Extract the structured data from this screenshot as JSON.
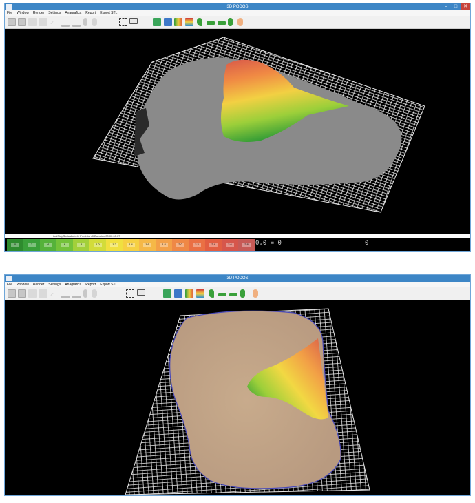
{
  "window1": {
    "title": "3D PODOS",
    "menu": [
      "File",
      "Window",
      "Render",
      "Settings",
      "Anagrafica",
      "Report",
      "Export STL"
    ],
    "status_text": "toolStripStatusLabel1  Precision 0  Duration 00:00:00.07",
    "legend_labels": [
      "0",
      "2",
      "4",
      "6",
      "8",
      "1.0",
      "1.2",
      "1.4",
      "1.6",
      "1.8",
      "2.0",
      "2.2",
      "2.4",
      "2.6",
      "2.8"
    ],
    "readout_left": "0,0 = 0",
    "readout_right": "0"
  },
  "window2": {
    "title": "3D PODOS",
    "menu": [
      "File",
      "Window",
      "Render",
      "Settings",
      "Anagrafica",
      "Report",
      "Export STL"
    ]
  },
  "colors": {
    "titlebar": "#3d86c6",
    "close": "#c7433b",
    "viewport": "#000000",
    "mesh": "#e6e6e6",
    "foot_gray": "#8a8a8a",
    "foot_skin": "#c8a98c",
    "legend": [
      "#2e8b2e",
      "#3aa03a",
      "#55b23a",
      "#73c23a",
      "#a2d03a",
      "#d2dc3a",
      "#f0e040",
      "#f6d043",
      "#f5b847",
      "#f3a048",
      "#ef8846",
      "#ea7044",
      "#e25e42",
      "#d6564b",
      "#c75a56"
    ]
  },
  "icons": {
    "toolbar_left": [
      "save-icon",
      "grid-icon",
      "panel-icon",
      "panel-icon",
      "foot-icon",
      "foot-side-icon",
      "foot-flat-icon",
      "bottle-icon",
      "shape-icon"
    ],
    "toolbar_mid": [
      "select-icon",
      "monitor-icon"
    ],
    "toolbar_right": [
      "save-green-icon",
      "grid-blue-icon",
      "heatmap-icon",
      "gradient-icon",
      "foot-green-icon",
      "foot-side-green-icon",
      "foot-flat-green-icon",
      "foot-small-green-icon",
      "ear-icon"
    ]
  }
}
